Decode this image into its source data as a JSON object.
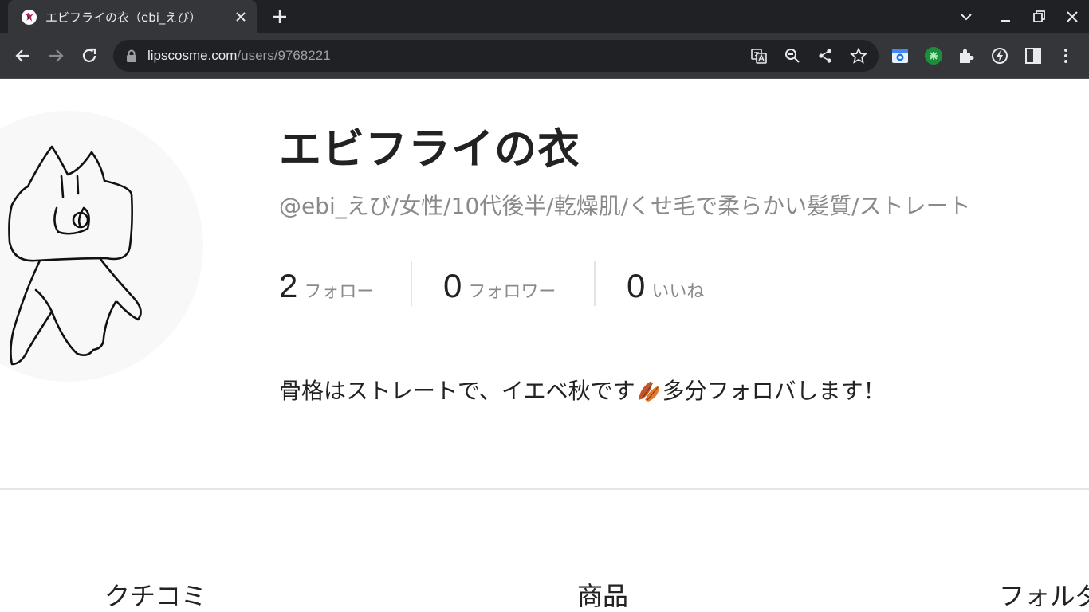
{
  "browser": {
    "tab_title": "エビフライの衣（ebi_えび）",
    "url_host": "lipscosme.com",
    "url_path": "/users/9768221"
  },
  "profile": {
    "name": "エビフライの衣",
    "subtitle": "@ebi_えび/女性/10代後半/乾燥肌/くせ毛で柔らかい髪質/ストレート",
    "stats": {
      "follow_count": "2",
      "follow_label": "フォロー",
      "follower_count": "0",
      "follower_label": "フォロワー",
      "like_count": "0",
      "like_label": "いいね"
    },
    "bio_before": "骨格はストレートで、イエベ秋です",
    "bio_after": "多分フォロバします！"
  },
  "tabs": {
    "reviews": "クチコミ",
    "products": "商品",
    "folders": "フォルダ"
  }
}
